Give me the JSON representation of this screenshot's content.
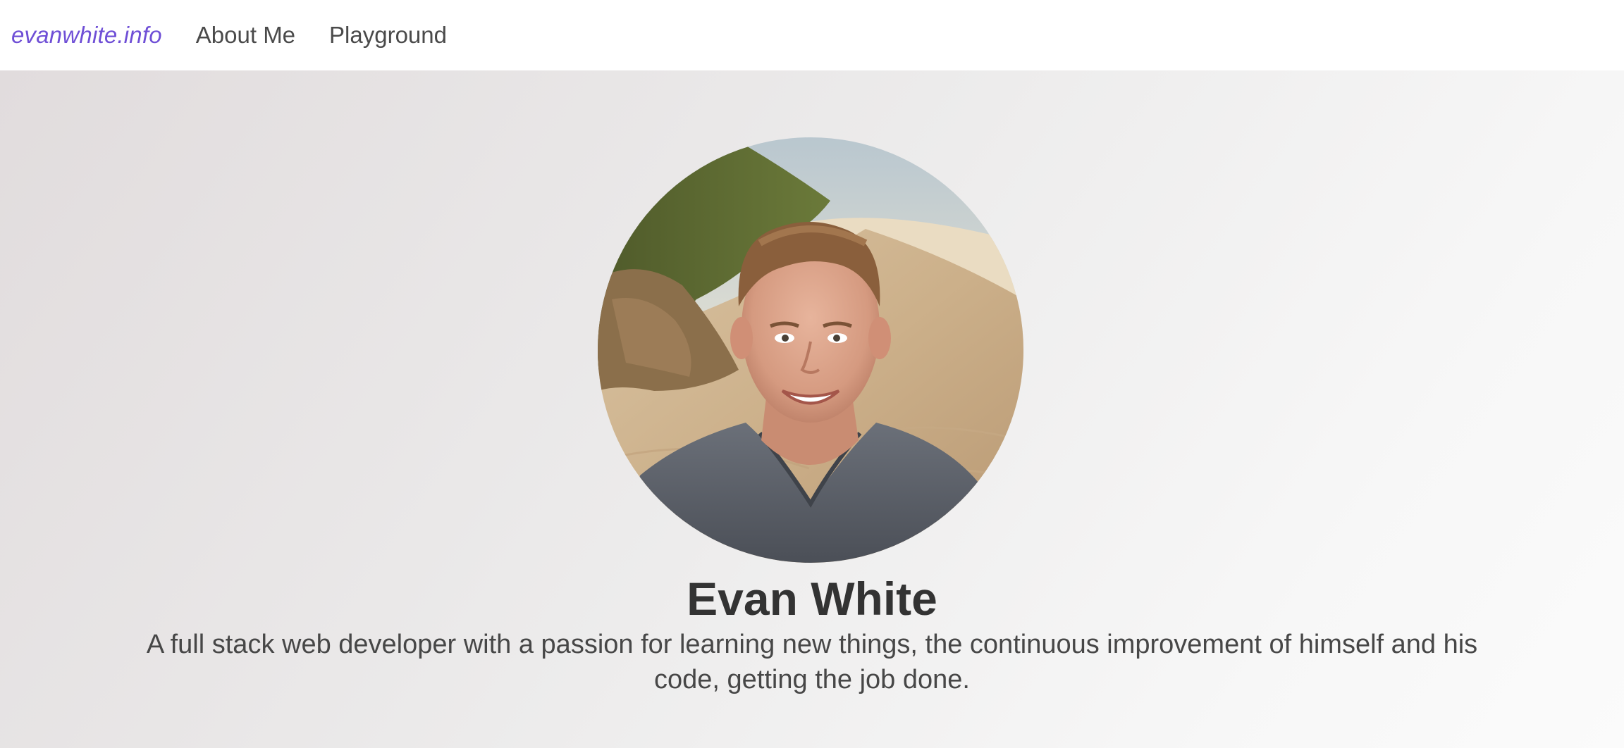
{
  "nav": {
    "brand": "evanwhite.info",
    "links": [
      {
        "label": "About Me"
      },
      {
        "label": "Playground"
      }
    ]
  },
  "hero": {
    "name": "Evan White",
    "tagline": "A full stack web developer with a passion for learning new things, the continuous improvement of himself and his code, getting the job done."
  },
  "colors": {
    "brand": "#6f4fd6",
    "heading": "#333333",
    "nav_text": "#4a4a4a"
  }
}
